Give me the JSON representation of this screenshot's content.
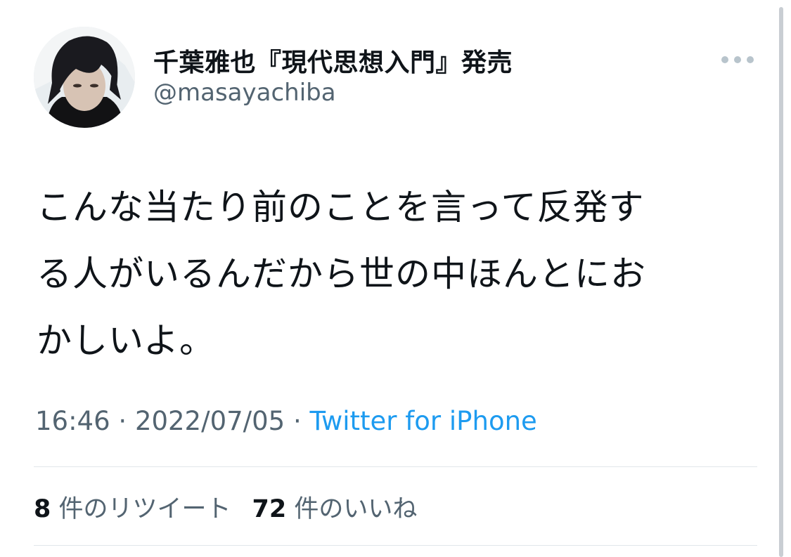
{
  "author": {
    "display_name": "千葉雅也『現代思想入門』発売",
    "handle": "@masayachiba",
    "avatar_icon": "profile-photo"
  },
  "tweet": {
    "text": "こんな当たり前のことを言って反発す\nる人がいるんだから世の中ほんとにお\nかしいよ。"
  },
  "meta": {
    "time": "16:46",
    "separator": " · ",
    "date": "2022/07/05",
    "source": "Twitter for iPhone"
  },
  "stats": {
    "retweet_count": "8",
    "retweet_label": " 件のリツイート",
    "like_count": "72",
    "like_label": " 件のいいね"
  },
  "icons": {
    "more": "more-horizontal-icon"
  },
  "colors": {
    "link": "#1d9bf0",
    "secondary_text": "#536471",
    "primary_text": "#0f1419",
    "divider": "#e1e6ea"
  }
}
